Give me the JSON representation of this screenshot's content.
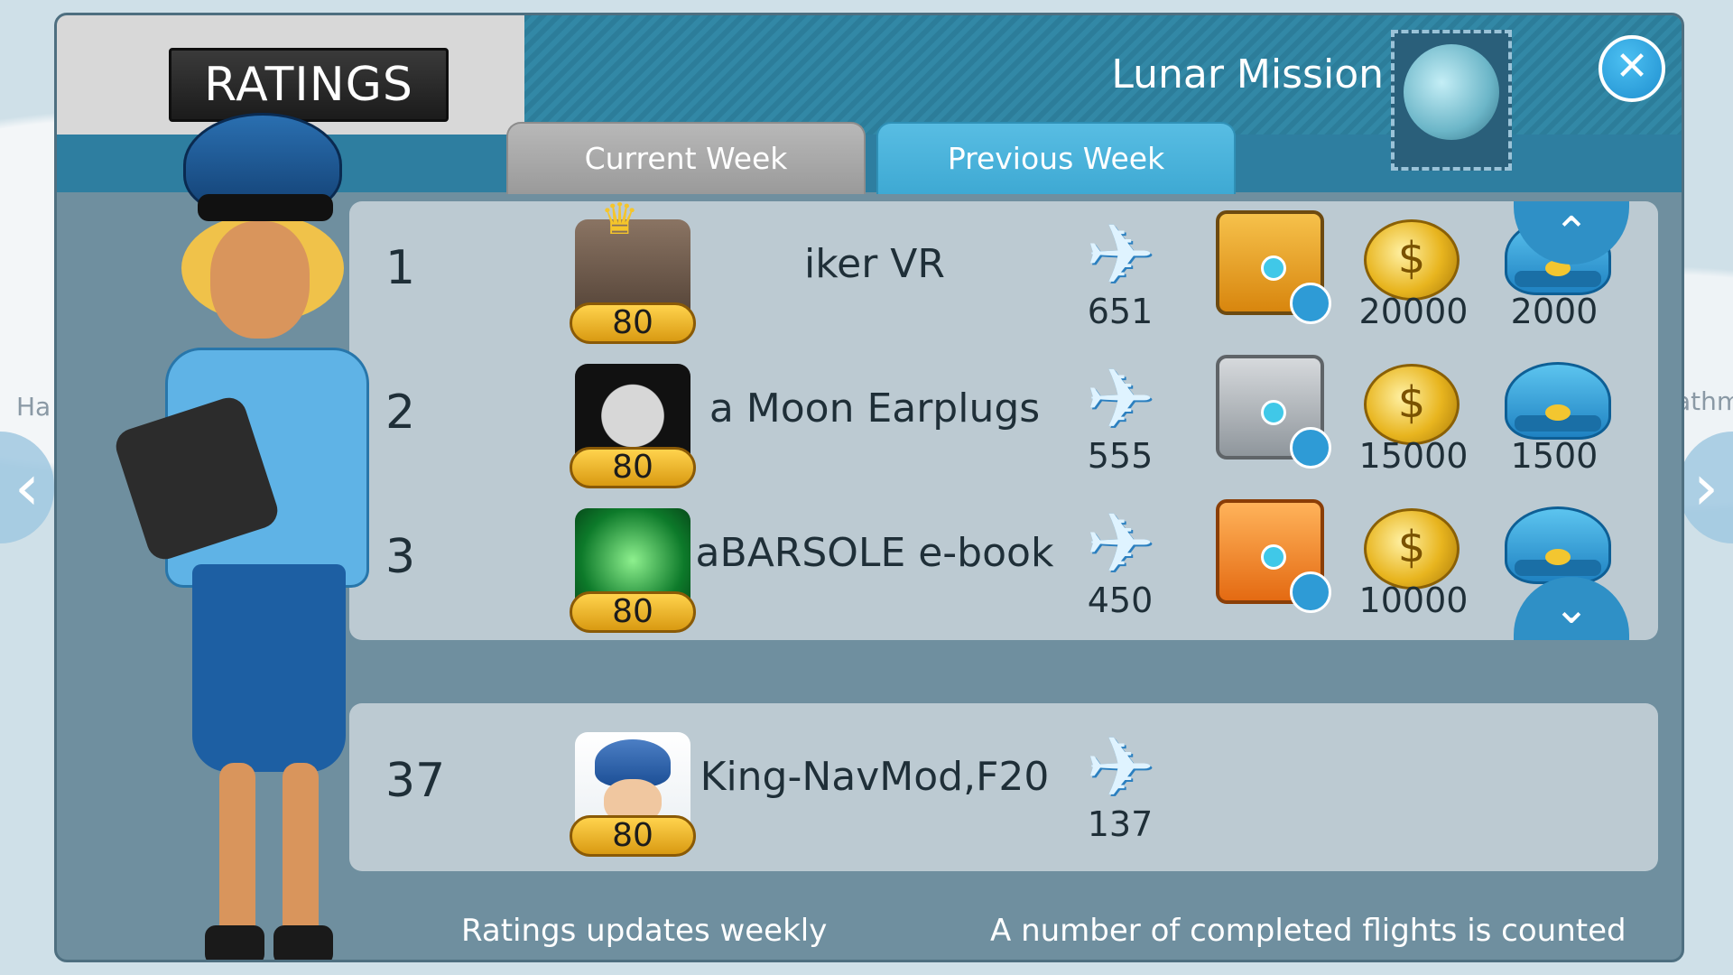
{
  "header": {
    "title": "RATINGS",
    "mission": "Lunar Mission",
    "close_symbol": "✕"
  },
  "tabs": [
    {
      "label": "Current Week",
      "selected": false
    },
    {
      "label": "Previous Week",
      "selected": true
    }
  ],
  "map_text": {
    "left": "Ha",
    "right": "athm"
  },
  "leaderboard": [
    {
      "rank": "1",
      "name": "iker VR",
      "badge": "80",
      "flights": "651",
      "chest": "gold",
      "coins": "20000",
      "caps": "2000",
      "crown": true
    },
    {
      "rank": "2",
      "name": "a Moon Earplugs",
      "badge": "80",
      "flights": "555",
      "chest": "silver",
      "coins": "15000",
      "caps": "1500",
      "crown": false
    },
    {
      "rank": "3",
      "name": "aBARSOLE e-book",
      "badge": "80",
      "flights": "450",
      "chest": "bronze",
      "coins": "10000",
      "caps": "",
      "crown": false
    }
  ],
  "player": {
    "rank": "37",
    "name": "King-NavMod,F20",
    "badge": "80",
    "flights": "137"
  },
  "footer": {
    "left": "Ratings updates weekly",
    "right": "A number of completed flights is counted"
  },
  "icons": {
    "plane": "✈",
    "coin": "$",
    "crown": "♛",
    "up": "⌃",
    "down": "⌄",
    "left": "‹",
    "right": "›"
  },
  "colors": {
    "chest_gold": "#e7a21e",
    "chest_silver": "#a8aeb3",
    "chest_bronze": "#f08a28",
    "accent": "#3ea9d3"
  }
}
